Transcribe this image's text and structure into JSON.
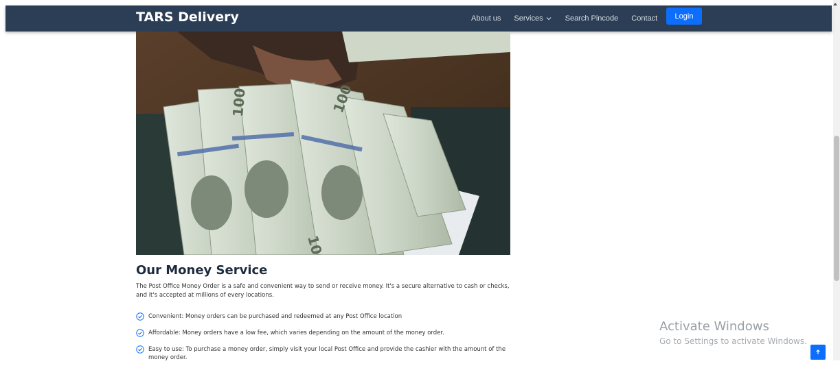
{
  "header": {
    "brand": "TARS Delivery",
    "nav": [
      {
        "label": "About us"
      },
      {
        "label": "Services"
      },
      {
        "label": "Search Pincode"
      },
      {
        "label": "Contact"
      }
    ],
    "login_label": "Login",
    "bg_color": "#2c3e55",
    "accent": "#0d6efd"
  },
  "section": {
    "title": "Our Money Service",
    "description": "The Post Office Money Order is a safe and convenient way to send or receive money. It's a secure alternative to cash or checks, and it's accepted at millions of every locations.",
    "features": [
      "Convenient: Money orders can be purchased and redeemed at any Post Office location",
      "Affordable: Money orders have a low fee, which varies depending on the amount of the money order.",
      "Easy to use: To purchase a money order, simply visit your local Post Office and provide the cashier with the amount of the money order."
    ]
  },
  "watermark": {
    "line1": "Activate Windows",
    "line2": "Go to Settings to activate Windows."
  },
  "icons": {
    "check": "check-circle-icon",
    "chevron": "chevron-down-icon",
    "back_to_top": "arrow-up-icon"
  }
}
